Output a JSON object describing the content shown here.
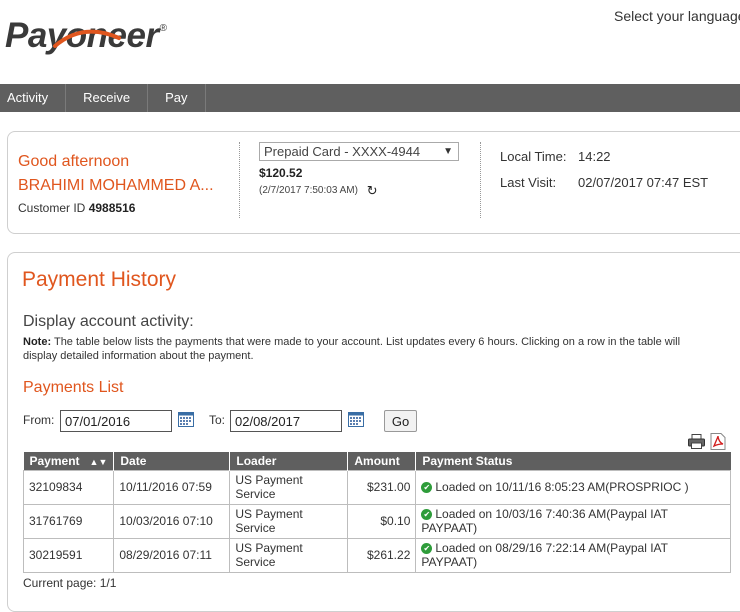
{
  "header": {
    "logo_text": "Payoneer",
    "language_prompt": "Select your language"
  },
  "nav": {
    "items": [
      {
        "label": "Activity"
      },
      {
        "label": "Receive"
      },
      {
        "label": "Pay"
      }
    ]
  },
  "account": {
    "greeting": "Good afternoon",
    "name": "BRAHIMI MOHAMMED A...",
    "customer_id_label": "Customer ID",
    "customer_id": "4988516",
    "card_selected": "Prepaid Card - XXXX-4944",
    "balance": "$120.52",
    "balance_time": "(2/7/2017 7:50:03 AM)",
    "local_time_label": "Local Time:",
    "local_time": "14:22",
    "last_visit_label": "Last Visit:",
    "last_visit": "02/07/2017 07:47 EST"
  },
  "history": {
    "title": "Payment History",
    "subtitle": "Display account activity:",
    "note_label": "Note:",
    "note_text": "The table below lists the payments that were made to your account. List updates every 6 hours. Clicking on a row in the table will display detailed information about the payment.",
    "list_title": "Payments List",
    "from_label": "From:",
    "from_value": "07/01/2016",
    "to_label": "To:",
    "to_value": "02/08/2017",
    "go_label": "Go",
    "columns": [
      "Payment",
      "Date",
      "Loader",
      "Amount",
      "Payment Status"
    ],
    "rows": [
      {
        "payment": "32109834",
        "date": "10/11/2016 07:59",
        "loader": "US Payment Service",
        "amount": "$231.00",
        "status": "Loaded on 10/11/16 8:05:23 AM(PROSPRIOC )"
      },
      {
        "payment": "31761769",
        "date": "10/03/2016 07:10",
        "loader": "US Payment Service",
        "amount": "$0.10",
        "status": "Loaded on 10/03/16 7:40:36 AM(Paypal IAT PAYPAAT)"
      },
      {
        "payment": "30219591",
        "date": "08/29/2016 07:11",
        "loader": "US Payment Service",
        "amount": "$261.22",
        "status": "Loaded on 08/29/16 7:22:14 AM(Paypal IAT PAYPAAT)"
      }
    ],
    "current_page": "Current page: 1/1"
  },
  "colors": {
    "accent": "#e0561e",
    "nav_bg": "#5f5f5f",
    "status_ok": "#2e9c3a"
  }
}
